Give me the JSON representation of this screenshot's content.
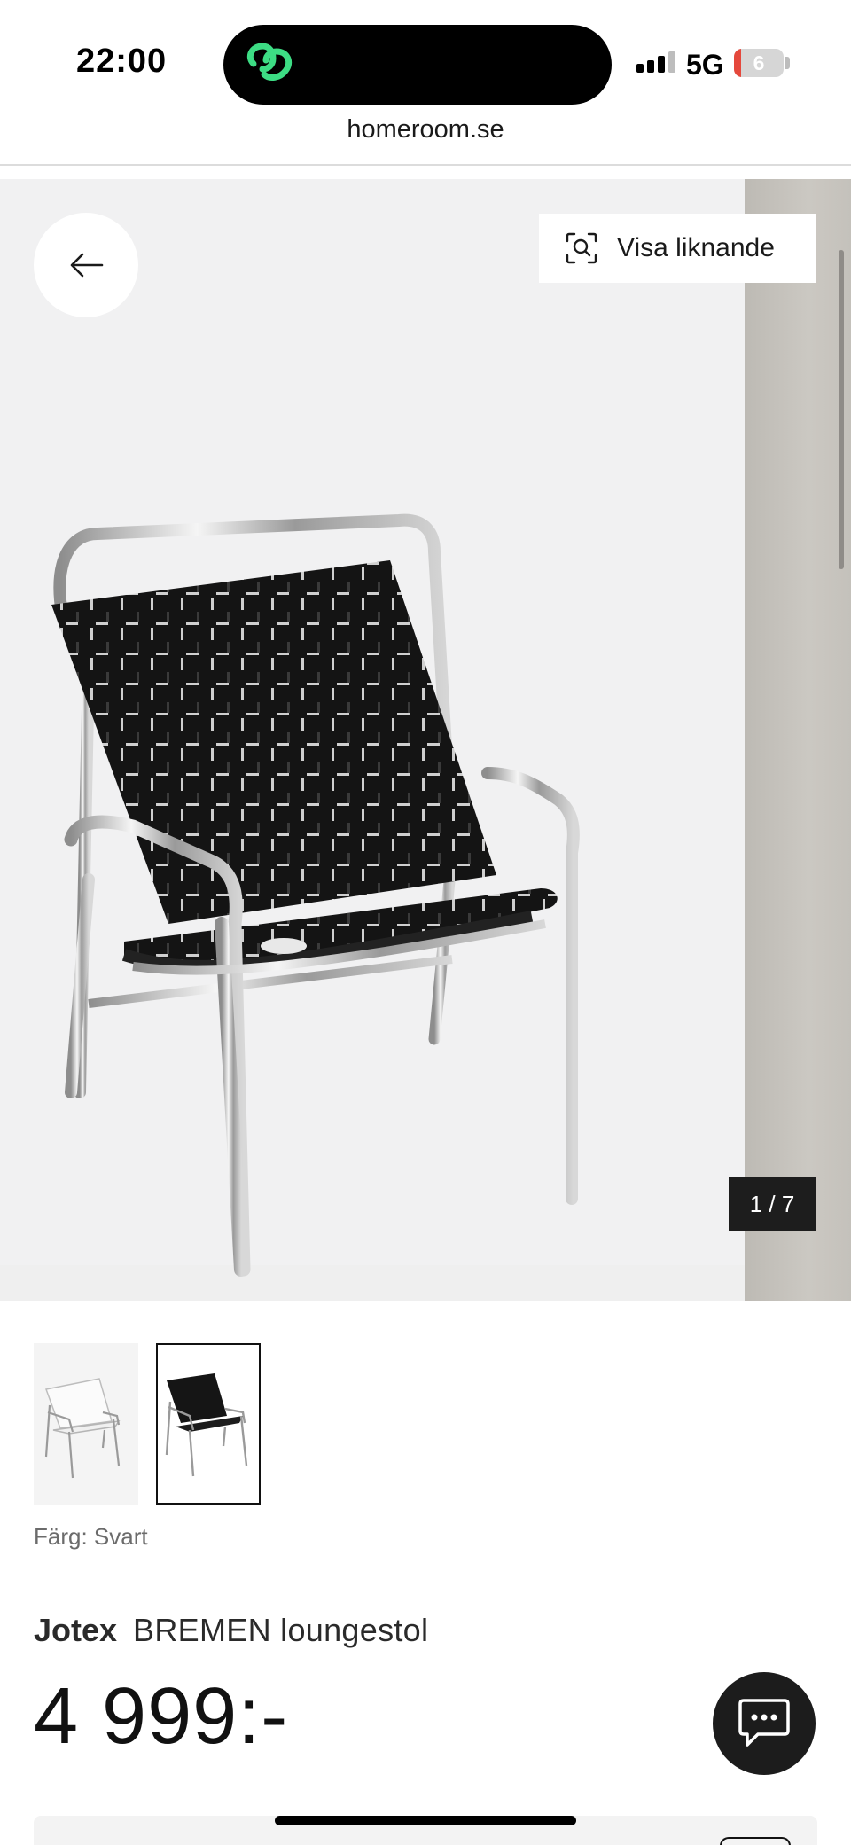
{
  "status_bar": {
    "time": "22:00",
    "network": "5G",
    "battery": {
      "level_text": "6",
      "level_fraction": 0.06,
      "low_color": "#e5483c"
    },
    "island_icon": "app-link-icon",
    "island_icon_color": "#3ddc84"
  },
  "browser": {
    "url": "homeroom.se"
  },
  "gallery": {
    "similar_button_label": "Visa liknande",
    "counter": "1 / 7",
    "icons": {
      "back": "arrow-left-icon",
      "similar": "visual-search-icon"
    }
  },
  "thumbnails": [
    {
      "name": "white-variant",
      "selected": false
    },
    {
      "name": "black-variant",
      "selected": true
    }
  ],
  "product": {
    "color_label": "Färg: Svart",
    "brand": "Jotex",
    "name": "BREMEN loungestol",
    "price": "4 999:-"
  },
  "chat": {
    "icon": "chat-bubble-icon"
  }
}
